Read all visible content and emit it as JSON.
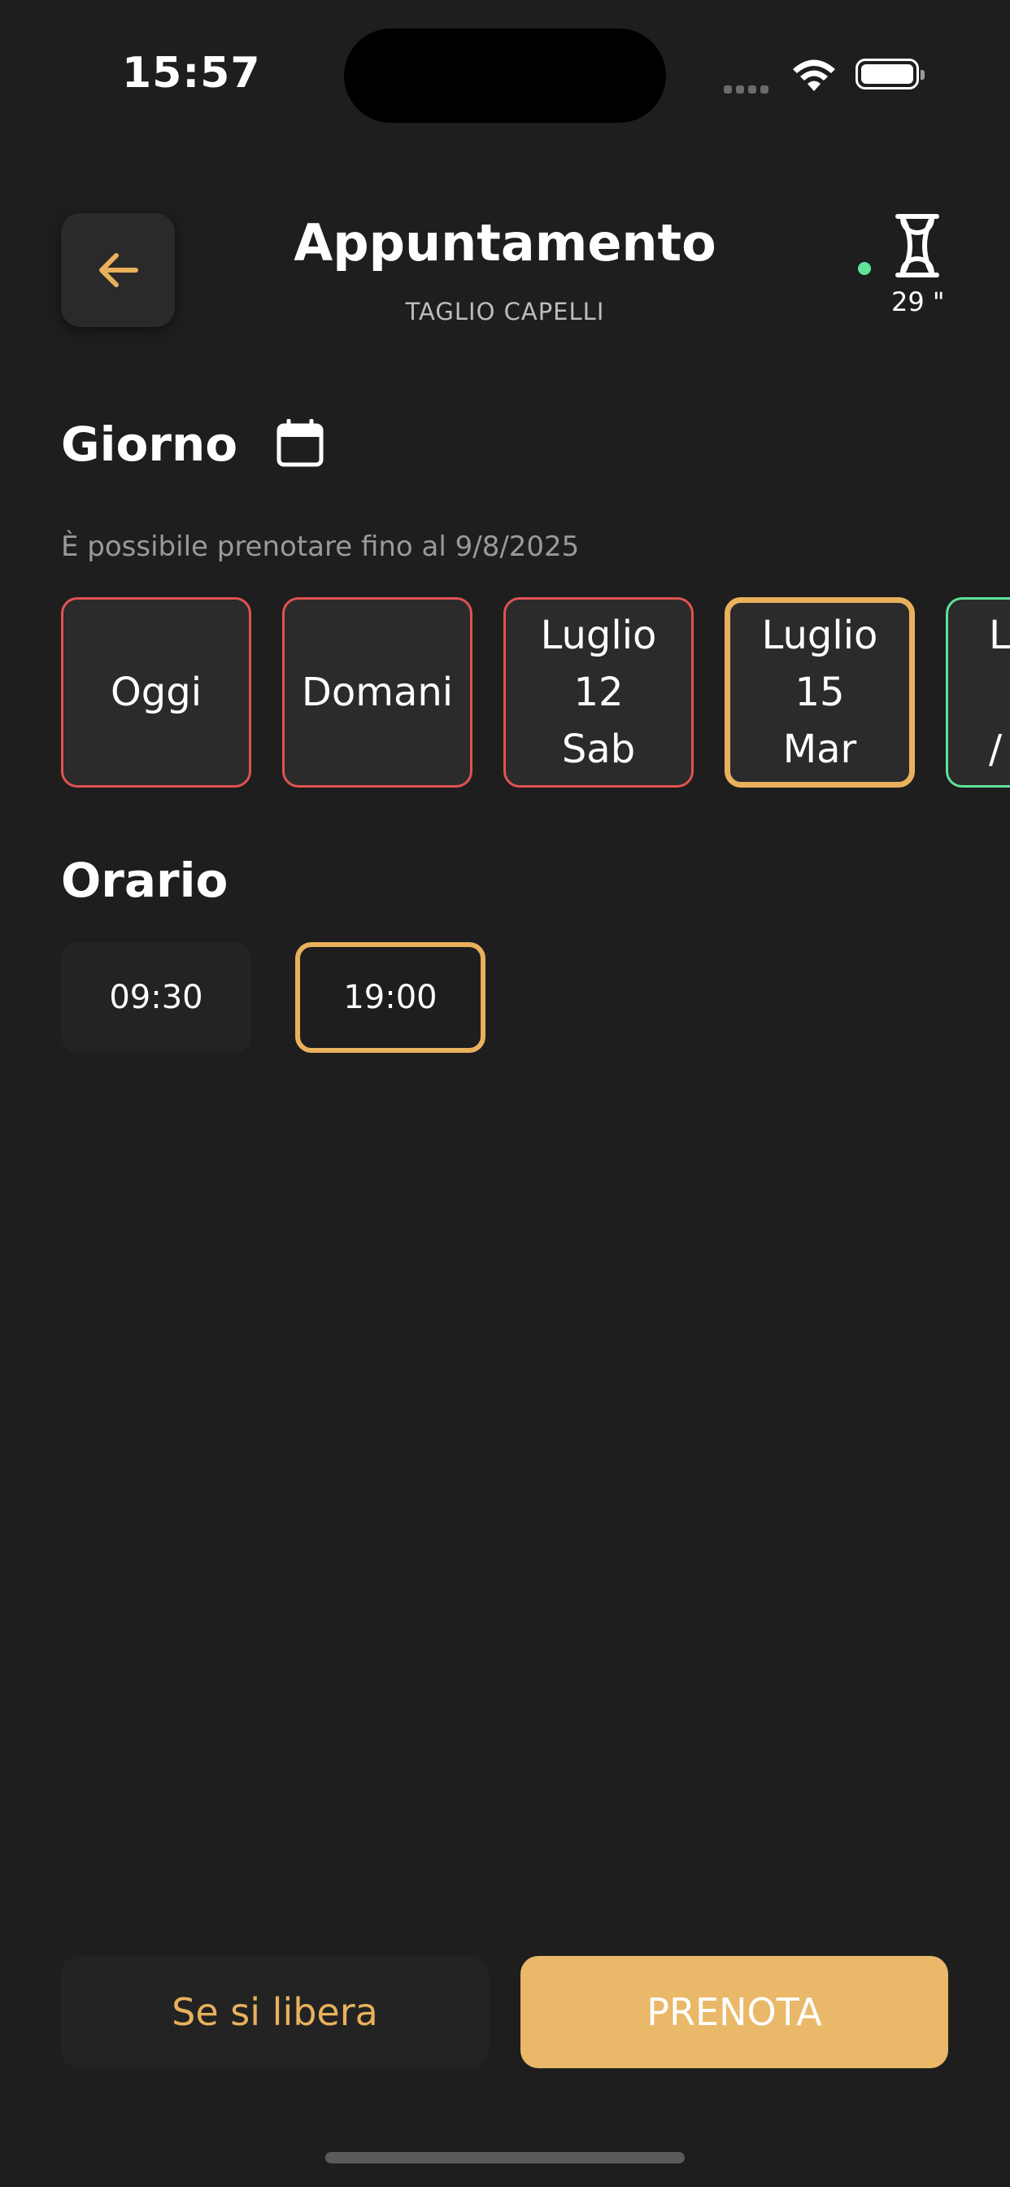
{
  "status_bar": {
    "time": "15:57"
  },
  "header": {
    "title": "Appuntamento",
    "subtitle": "TAGLIO CAPELLI",
    "timer": "29 \"",
    "timer_dot_color": "#5ee39a",
    "accent_color": "#e9b15c"
  },
  "giorno": {
    "title": "Giorno",
    "note": "È possibile prenotare fino al 9/8/2025",
    "days": [
      {
        "lines": [
          "Oggi"
        ],
        "status": "unavailable"
      },
      {
        "lines": [
          "Domani"
        ],
        "status": "unavailable"
      },
      {
        "lines": [
          "Luglio",
          "12",
          "Sab"
        ],
        "status": "unavailable"
      },
      {
        "lines": [
          "Luglio",
          "15",
          "Mar"
        ],
        "status": "selected"
      },
      {
        "lines": [
          "L",
          "",
          "/"
        ],
        "status": "available"
      }
    ]
  },
  "orario": {
    "title": "Orario",
    "slots": [
      {
        "label": "09:30",
        "selected": false
      },
      {
        "label": "19:00",
        "selected": true
      }
    ]
  },
  "actions": {
    "waitlist_label": "Se si libera",
    "book_label": "PRENOTA"
  }
}
